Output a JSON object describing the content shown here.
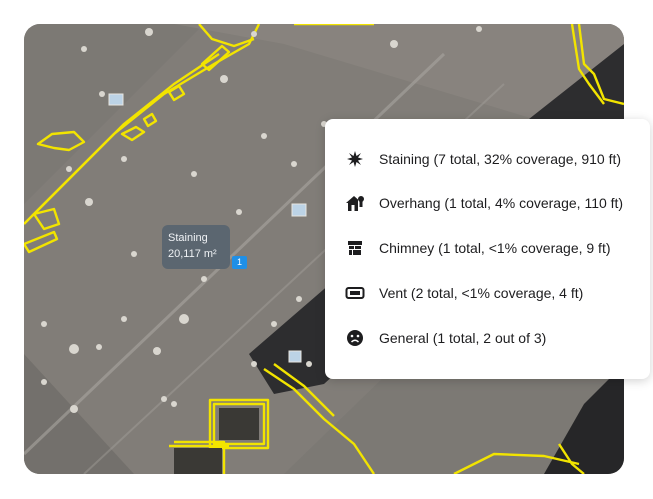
{
  "map": {
    "tooltip": {
      "label": "Staining",
      "area": "20,117 m²"
    },
    "pin_label": "1",
    "colors": {
      "highlight": "#f2e400",
      "roof": "#7a7873",
      "pin": "#1f8fe6"
    }
  },
  "legend": {
    "items": [
      {
        "icon": "splat-icon",
        "label": "Staining (7 total, 32% coverage, 910 ft)"
      },
      {
        "icon": "overhang-house-icon",
        "label": "Overhang (1 total, 4% coverage, 110 ft)"
      },
      {
        "icon": "chimney-icon",
        "label": "Chimney (1 total, <1% coverage, 9 ft)"
      },
      {
        "icon": "vent-icon",
        "label": "Vent (2 total, <1% coverage, 4 ft)"
      },
      {
        "icon": "sad-face-icon",
        "label": "General (1 total, 2 out of 3)"
      }
    ]
  }
}
